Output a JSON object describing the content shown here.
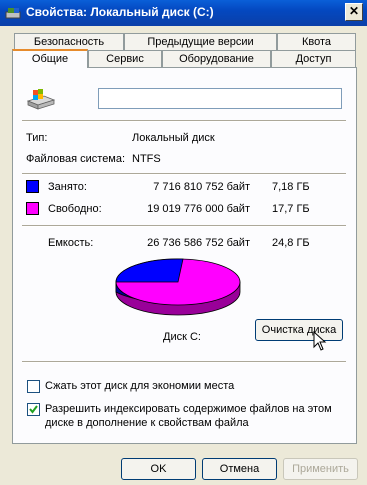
{
  "window": {
    "title": "Свойства: Локальный диск (C:)",
    "close_symbol": "✕"
  },
  "tabs": {
    "row1": [
      "Безопасность",
      "Предыдущие версии",
      "Квота"
    ],
    "row2": [
      "Общие",
      "Сервис",
      "Оборудование",
      "Доступ"
    ],
    "active": "Общие"
  },
  "general": {
    "drive_name_value": "",
    "type_label": "Тип:",
    "type_value": "Локальный диск",
    "fs_label": "Файловая система:",
    "fs_value": "NTFS",
    "used": {
      "label": "Занято:",
      "bytes": "7 716 810 752 байт",
      "size": "7,18 ГБ",
      "color": "#0000ff"
    },
    "free": {
      "label": "Свободно:",
      "bytes": "19 019 776 000 байт",
      "size": "17,7 ГБ",
      "color": "#ff00ff"
    },
    "capacity": {
      "label": "Емкость:",
      "bytes": "26 736 586 752 байт",
      "size": "24,8 ГБ"
    },
    "disk_label": "Диск C:",
    "cleanup_button": "Очистка диска",
    "compress_label": "Сжать этот диск для экономии места",
    "compress_checked": false,
    "index_label_line1": "Разрешить индексировать содержимое файлов на этом",
    "index_label_line2": "диске в дополнение к свойствам файла",
    "index_checked": true
  },
  "pie_fractions": {
    "used": 0.289,
    "free": 0.711
  },
  "buttons": {
    "ok": "OK",
    "cancel": "Отмена",
    "apply": "Применить"
  }
}
